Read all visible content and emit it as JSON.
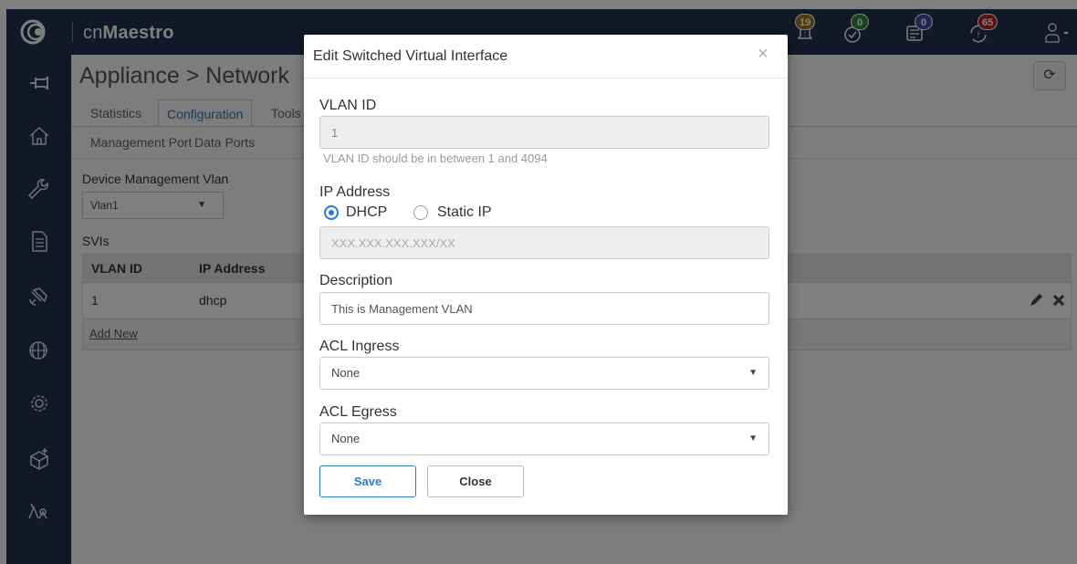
{
  "topbar": {
    "brand_prefix": "cn",
    "brand_main": "Maestro",
    "badges": {
      "alarms": "19",
      "tasks": "0",
      "jobs": "0",
      "updates": "65"
    },
    "colors": {
      "alarms": "#9c7a1e",
      "tasks": "#2e8b3e",
      "jobs": "#4a4fa0",
      "updates": "#b3262a"
    }
  },
  "sidebar": {
    "icons": [
      "pin-icon",
      "home-icon",
      "wrench-icon",
      "report-icon",
      "satellite-icon",
      "globe-icon",
      "gear-icon",
      "box-add-icon",
      "users-icon"
    ]
  },
  "main": {
    "title": "Appliance > Network",
    "tabs": [
      "Statistics",
      "Configuration",
      "Tools"
    ],
    "active_tab": "Configuration",
    "subtabs": [
      "Management Port",
      "Data Ports"
    ],
    "device_mgmt_label": "Device Management Vlan",
    "device_mgmt_value": "Vlan1",
    "svis_label": "SVIs",
    "table": {
      "headers": [
        "VLAN ID",
        "IP Address"
      ],
      "rows": [
        {
          "vlan_id": "1",
          "ip": "dhcp"
        }
      ],
      "add_new": "Add New"
    }
  },
  "modal": {
    "title": "Edit Switched Virtual Interface",
    "close_glyph": "×",
    "vlan_label": "VLAN ID",
    "vlan_value": "1",
    "vlan_help": "VLAN ID should be in between 1 and 4094",
    "ip_label": "IP Address",
    "ip_options": [
      "DHCP",
      "Static IP"
    ],
    "ip_selected": "DHCP",
    "ip_placeholder": "XXX.XXX.XXX.XXX/XX",
    "desc_label": "Description",
    "desc_value": "This is Management VLAN",
    "acl_ingress_label": "ACL Ingress",
    "acl_ingress_value": "None",
    "acl_egress_label": "ACL Egress",
    "acl_egress_value": "None",
    "save_label": "Save",
    "close_label": "Close"
  }
}
